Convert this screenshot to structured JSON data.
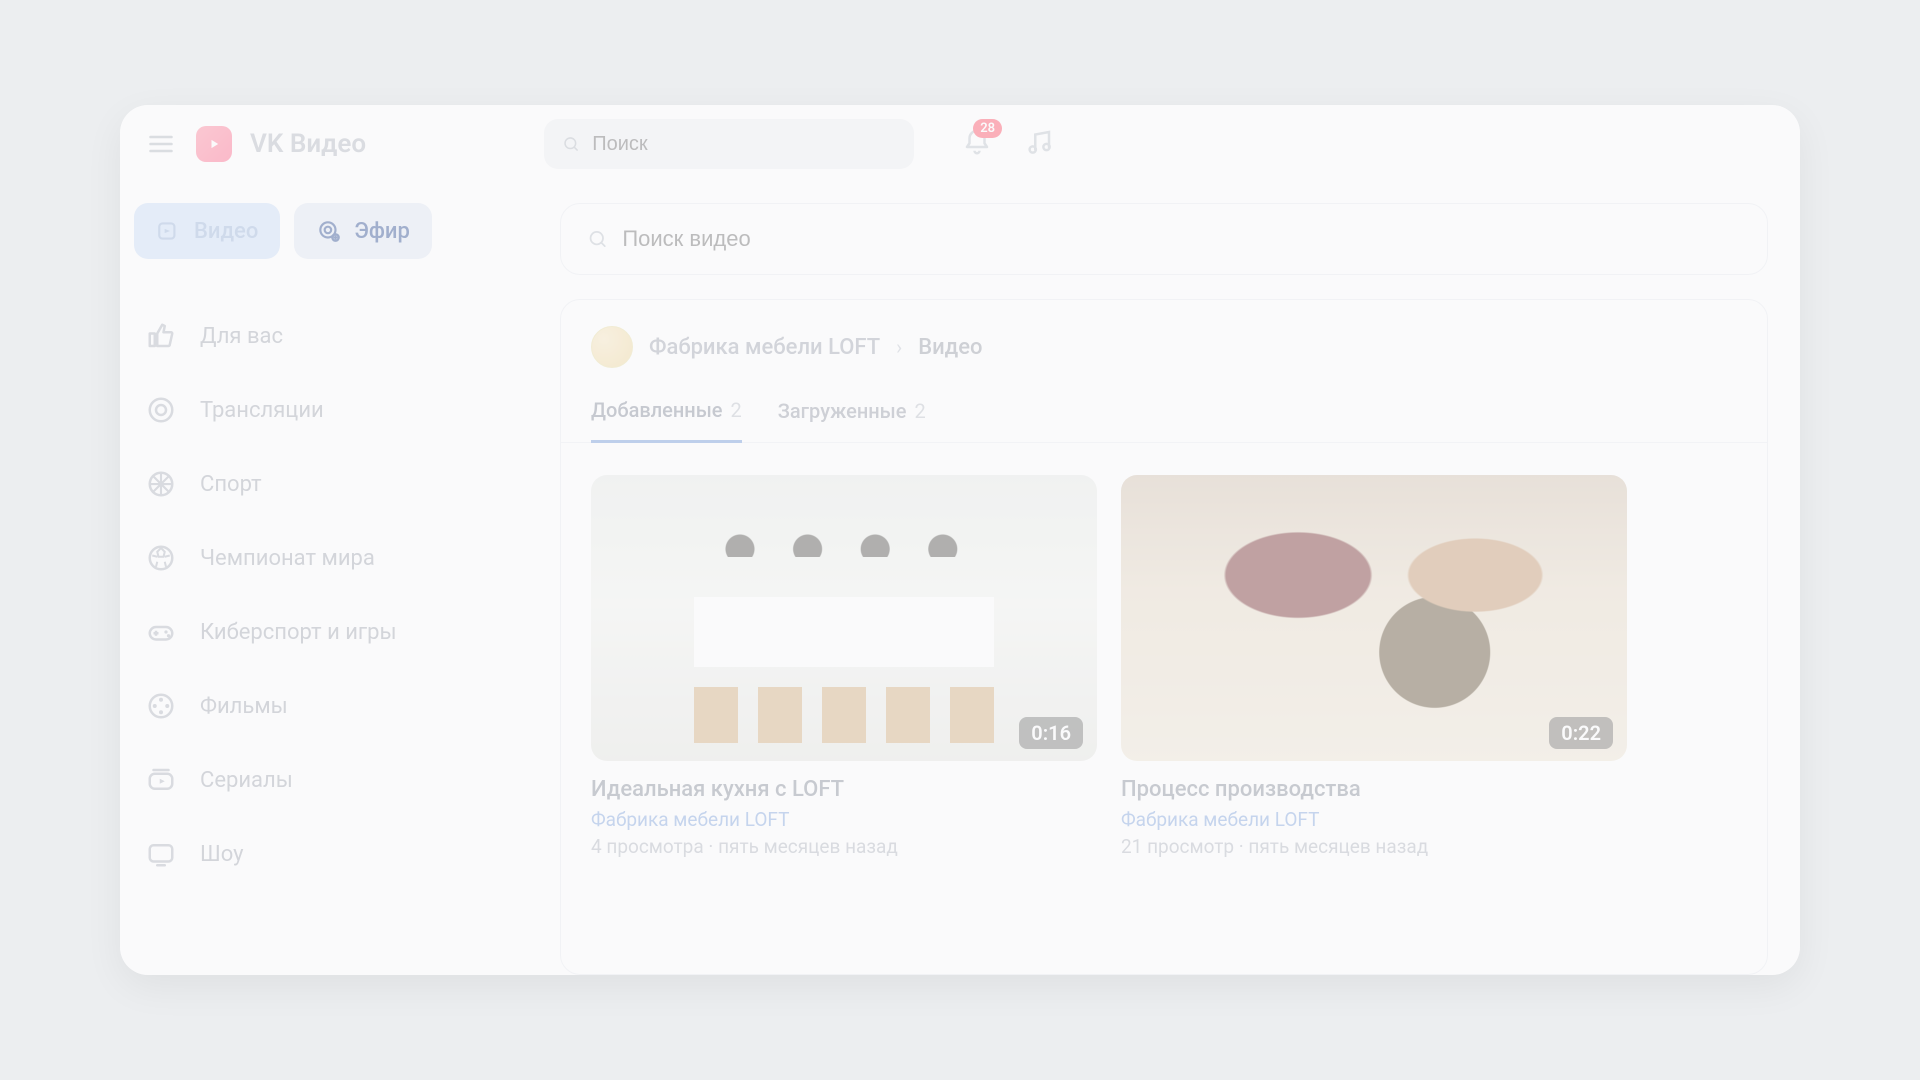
{
  "brand": "VK Видео",
  "header": {
    "search_placeholder": "Поиск",
    "notifications_count": "28"
  },
  "sidebar": {
    "tab_video": "Видео",
    "tab_live": "Эфир",
    "items": [
      {
        "icon": "thumb-up",
        "label": "Для вас"
      },
      {
        "icon": "target",
        "label": "Трансляции"
      },
      {
        "icon": "ball",
        "label": "Спорт"
      },
      {
        "icon": "soccer",
        "label": "Чемпионат мира"
      },
      {
        "icon": "gamepad",
        "label": "Киберспорт и игры"
      },
      {
        "icon": "film",
        "label": "Фильмы"
      },
      {
        "icon": "series",
        "label": "Сериалы"
      },
      {
        "icon": "tv",
        "label": "Шоу"
      }
    ]
  },
  "main": {
    "video_search_placeholder": "Поиск видео",
    "breadcrumb": {
      "channel": "Фабрика мебели LOFT",
      "current": "Видео"
    },
    "filters": [
      {
        "label": "Добавленные",
        "count": "2",
        "active": true
      },
      {
        "label": "Загруженные",
        "count": "2",
        "active": false
      }
    ],
    "videos": [
      {
        "duration": "0:16",
        "title": "Идеальная кухня с LOFT",
        "channel": "Фабрика мебели LOFT",
        "meta": "4 просмотра · пять месяцев назад"
      },
      {
        "duration": "0:22",
        "title": "Процесс производства",
        "channel": "Фабрика мебели LOFT",
        "meta": "21 просмотр · пять месяцев назад"
      }
    ]
  }
}
